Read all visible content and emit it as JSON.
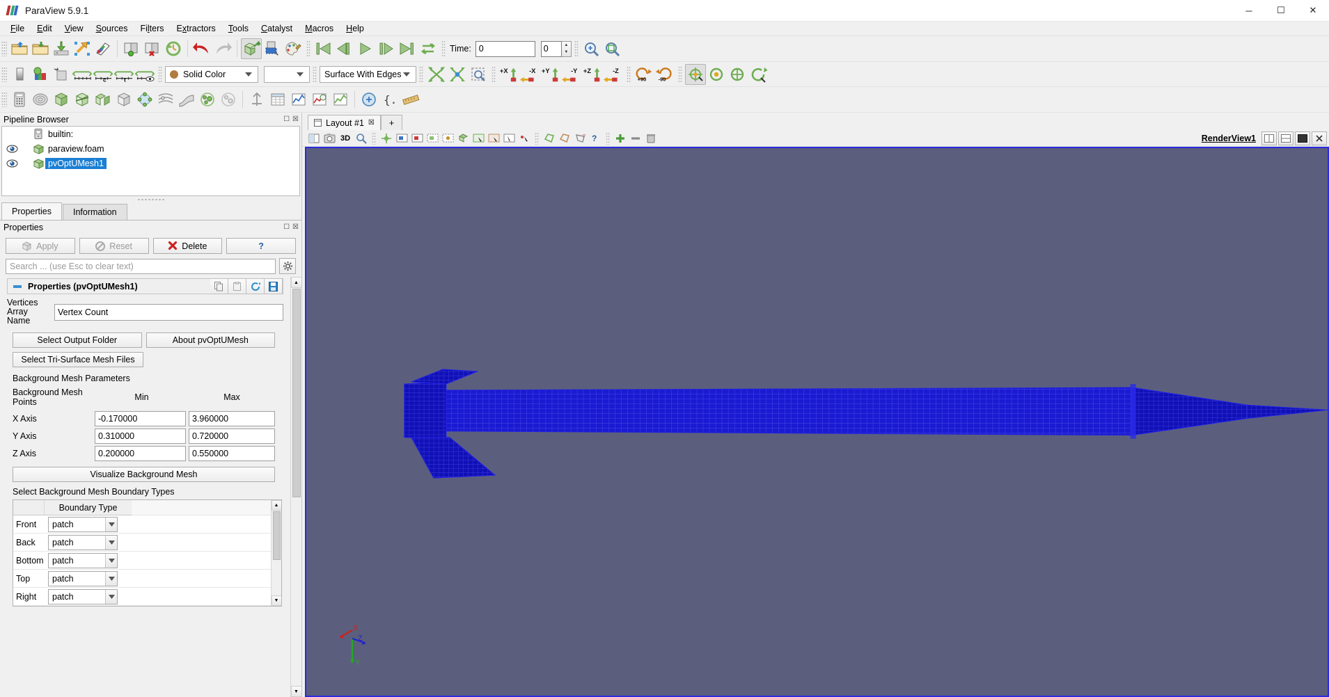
{
  "window": {
    "title": "ParaView 5.9.1",
    "minimize": "─",
    "maximize": "☐",
    "close": "✕"
  },
  "menubar": {
    "items": [
      "File",
      "Edit",
      "View",
      "Sources",
      "Filters",
      "Extractors",
      "Tools",
      "Catalyst",
      "Macros",
      "Help"
    ]
  },
  "toolbar_main": {
    "buttons": [
      {
        "name": "open-file-icon",
        "tip": "Open"
      },
      {
        "name": "recent-files-icon",
        "tip": "Recent Files"
      },
      {
        "name": "save-state-icon",
        "tip": "Save State"
      },
      {
        "name": "load-state-icon",
        "tip": "Load State"
      },
      {
        "name": "save-data-icon",
        "tip": "Save Data"
      },
      {
        "name": "connect-server-icon",
        "tip": "Connect"
      },
      {
        "name": "disconnect-server-icon",
        "tip": "Disconnect"
      },
      {
        "name": "reset-session-icon",
        "tip": "Reset Session"
      },
      {
        "name": "undo-icon",
        "tip": "Undo"
      },
      {
        "name": "redo-icon",
        "tip": "Redo"
      },
      {
        "name": "camera-undo-icon",
        "tip": "Undo Camera"
      },
      {
        "name": "select-cells-icon",
        "tip": "Select Cells"
      },
      {
        "name": "color-palette-icon",
        "tip": "Edit Color Palette"
      }
    ]
  },
  "vcr": {
    "first_frame": "first-frame-icon",
    "prev_frame": "previous-frame-icon",
    "play": "play-icon",
    "next_frame": "next-frame-icon",
    "last_frame": "last-frame-icon",
    "loop": "loop-icon",
    "time_label": "Time:",
    "time_value": "0",
    "frame_value": "0"
  },
  "toolbar_right": {
    "zoom_to_data": "zoom-to-data-icon",
    "zoom_closest": "zoom-closest-to-data-icon"
  },
  "toolbar_repr": {
    "coloring": "Solid Color",
    "array_component": "",
    "representation": "Surface With Edges",
    "buttons": [
      {
        "name": "rescale-to-data-range-icon"
      },
      {
        "name": "rescale-to-custom-range-icon"
      },
      {
        "name": "rescale-to-temporal-range-icon"
      },
      {
        "name": "rescale-to-visible-range-icon"
      },
      {
        "name": "edit-color-map-icon"
      },
      {
        "name": "toggle-color-legend-icon"
      }
    ],
    "camera": [
      {
        "name": "reset-camera-icon",
        "label": ""
      },
      {
        "name": "zoom-to-box-icon",
        "label": ""
      },
      {
        "name": "zoom-to-data-icon",
        "label": ""
      },
      {
        "name": "positive-x-icon",
        "label": "+X"
      },
      {
        "name": "negative-x-icon",
        "label": "-X"
      },
      {
        "name": "positive-y-icon",
        "label": "+Y"
      },
      {
        "name": "negative-y-icon",
        "label": "-Y"
      },
      {
        "name": "positive-z-icon",
        "label": "+Z"
      },
      {
        "name": "negative-z-icon",
        "label": "-Z"
      },
      {
        "name": "rotate-90-ccw-icon",
        "label": "+90"
      },
      {
        "name": "rotate-90-cw-icon",
        "label": "-90"
      },
      {
        "name": "center-axes-icon",
        "label": ""
      },
      {
        "name": "show-center-icon",
        "label": ""
      },
      {
        "name": "pick-center-icon",
        "label": ""
      },
      {
        "name": "reset-center-icon",
        "label": ""
      }
    ]
  },
  "toolbar_filters": {
    "buttons": [
      {
        "name": "calculator-filter-icon"
      },
      {
        "name": "contour-filter-icon"
      },
      {
        "name": "clip-filter-icon"
      },
      {
        "name": "slice-filter-icon"
      },
      {
        "name": "threshold-filter-icon"
      },
      {
        "name": "extract-subset-filter-icon"
      },
      {
        "name": "glyph-filter-icon"
      },
      {
        "name": "stream-tracer-filter-icon"
      },
      {
        "name": "warp-filter-icon"
      },
      {
        "name": "group-datasets-filter-icon"
      },
      {
        "name": "extract-level-filter-icon"
      },
      {
        "name": "data-axes-icon"
      },
      {
        "name": "spreadsheet-view-icon"
      },
      {
        "name": "plot-over-line-icon"
      },
      {
        "name": "plot-data-over-time-icon"
      },
      {
        "name": "plot-selection-icon"
      },
      {
        "name": "python-calculator-icon"
      },
      {
        "name": "programmable-filter-icon"
      },
      {
        "name": "ruler-icon"
      }
    ]
  },
  "pipeline_browser": {
    "title": "Pipeline Browser",
    "items": [
      {
        "label": "builtin:",
        "icon": "server-icon",
        "eye": false,
        "selected": false
      },
      {
        "label": "paraview.foam",
        "icon": "dataset-icon",
        "eye": true,
        "selected": false
      },
      {
        "label": "pvOptUMesh1",
        "icon": "dataset-icon",
        "eye": true,
        "selected": true
      }
    ]
  },
  "property_tabs": {
    "tabs": [
      {
        "label": "Properties",
        "active": true
      },
      {
        "label": "Information",
        "active": false
      }
    ]
  },
  "properties": {
    "panel_title": "Properties",
    "apply_label": "Apply",
    "reset_label": "Reset",
    "delete_label": "Delete",
    "help_label": "?",
    "search_placeholder": "Search ... (use Esc to clear text)",
    "group_title": "Properties (pvOptUMesh1)",
    "vertices_label_line1": "Vertices Array",
    "vertices_label_line2": "Name",
    "vertices_value": "Vertex Count",
    "select_output_folder": "Select Output Folder",
    "about_button": "About pvOptUMesh",
    "select_tri_surface": "Select Tri-Surface Mesh Files",
    "bg_mesh_params_label": "Background Mesh Parameters",
    "bg_mesh_points_label": "Background Mesh Points",
    "min_header": "Min",
    "max_header": "Max",
    "axes": [
      {
        "name": "X Axis",
        "min": "-0.170000",
        "max": "3.960000"
      },
      {
        "name": "Y Axis",
        "min": "0.310000",
        "max": "0.720000"
      },
      {
        "name": "Z Axis",
        "min": "0.200000",
        "max": "0.550000"
      }
    ],
    "visualize_button": "Visualize Background Mesh",
    "boundary_section_label": "Select Background Mesh Boundary Types",
    "boundary_table": {
      "header": "Boundary Type",
      "rows": [
        {
          "name": "Front",
          "value": "patch"
        },
        {
          "name": "Back",
          "value": "patch"
        },
        {
          "name": "Bottom",
          "value": "patch"
        },
        {
          "name": "Top",
          "value": "patch"
        },
        {
          "name": "Right",
          "value": "patch"
        }
      ]
    }
  },
  "layout": {
    "tabs": [
      {
        "label": "Layout #1",
        "close": "☒"
      }
    ],
    "add_tab": "+"
  },
  "view_toolbar": {
    "buttons": [
      {
        "name": "split-horizontal-icon"
      },
      {
        "name": "camera-snapshot-icon"
      },
      {
        "name": "toggle-3d-label",
        "label": "3D"
      },
      {
        "name": "magnifier-icon"
      },
      {
        "name": "show-center-axes-icon"
      },
      {
        "name": "select-cells-on-icon"
      },
      {
        "name": "select-points-on-icon"
      },
      {
        "name": "select-cells-through-icon"
      },
      {
        "name": "select-points-through-icon"
      },
      {
        "name": "select-blocks-icon"
      },
      {
        "name": "interactive-select-cells-icon"
      },
      {
        "name": "interactive-select-points-icon"
      },
      {
        "name": "hover-cells-icon"
      },
      {
        "name": "hover-points-icon"
      },
      {
        "name": "select-cells-polygon-icon"
      },
      {
        "name": "select-points-polygon-icon"
      },
      {
        "name": "select-frustum-icon"
      },
      {
        "name": "query-selection-icon"
      },
      {
        "name": "add-selection-icon"
      },
      {
        "name": "subtract-selection-icon"
      },
      {
        "name": "clear-selection-icon"
      }
    ],
    "view_name": "RenderView1",
    "right_buttons": [
      {
        "name": "split-horizontal-button-icon"
      },
      {
        "name": "split-vertical-button-icon"
      },
      {
        "name": "maximize-view-button-icon"
      },
      {
        "name": "close-view-button-icon"
      }
    ]
  },
  "render_view": {
    "background_color": "#5b5f7d",
    "mesh_color": "#1414c8",
    "border_color": "#2a2ae0",
    "orientation_axes": {
      "x": "X",
      "y": "Y",
      "z": "Z",
      "x_color": "#cc2222",
      "y_color": "#22aa22",
      "z_color": "#2222cc"
    }
  }
}
